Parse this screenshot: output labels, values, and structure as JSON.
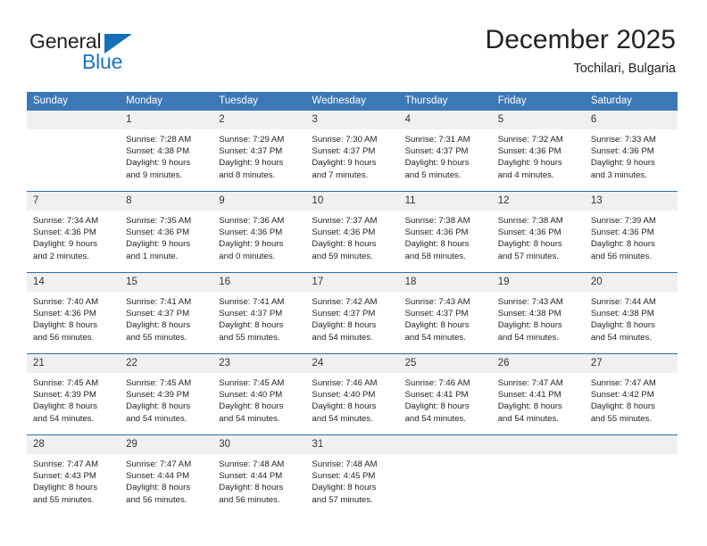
{
  "brand": {
    "name_top": "General",
    "name_bottom": "Blue",
    "triangle_color": "#1271b8",
    "blue_color": "#1b75bb",
    "dark_color": "#231f20"
  },
  "header": {
    "title": "December 2025",
    "location": "Tochilari, Bulgaria"
  },
  "theme": {
    "header_row_bg": "#3c78b5",
    "header_row_text": "#ffffff",
    "daynum_bg": "#f0f0f0",
    "row_divider": "#2e6da4",
    "body_text": "#242424"
  },
  "weekdays": [
    "Sunday",
    "Monday",
    "Tuesday",
    "Wednesday",
    "Thursday",
    "Friday",
    "Saturday"
  ],
  "weeks": [
    [
      {
        "day": "",
        "empty": true,
        "sunrise": "",
        "sunset": "",
        "daylight_line1": "",
        "daylight_line2": ""
      },
      {
        "day": "1",
        "empty": false,
        "sunrise": "Sunrise: 7:28 AM",
        "sunset": "Sunset: 4:38 PM",
        "daylight_line1": "Daylight: 9 hours",
        "daylight_line2": "and 9 minutes."
      },
      {
        "day": "2",
        "empty": false,
        "sunrise": "Sunrise: 7:29 AM",
        "sunset": "Sunset: 4:37 PM",
        "daylight_line1": "Daylight: 9 hours",
        "daylight_line2": "and 8 minutes."
      },
      {
        "day": "3",
        "empty": false,
        "sunrise": "Sunrise: 7:30 AM",
        "sunset": "Sunset: 4:37 PM",
        "daylight_line1": "Daylight: 9 hours",
        "daylight_line2": "and 7 minutes."
      },
      {
        "day": "4",
        "empty": false,
        "sunrise": "Sunrise: 7:31 AM",
        "sunset": "Sunset: 4:37 PM",
        "daylight_line1": "Daylight: 9 hours",
        "daylight_line2": "and 5 minutes."
      },
      {
        "day": "5",
        "empty": false,
        "sunrise": "Sunrise: 7:32 AM",
        "sunset": "Sunset: 4:36 PM",
        "daylight_line1": "Daylight: 9 hours",
        "daylight_line2": "and 4 minutes."
      },
      {
        "day": "6",
        "empty": false,
        "sunrise": "Sunrise: 7:33 AM",
        "sunset": "Sunset: 4:36 PM",
        "daylight_line1": "Daylight: 9 hours",
        "daylight_line2": "and 3 minutes."
      }
    ],
    [
      {
        "day": "7",
        "empty": false,
        "sunrise": "Sunrise: 7:34 AM",
        "sunset": "Sunset: 4:36 PM",
        "daylight_line1": "Daylight: 9 hours",
        "daylight_line2": "and 2 minutes."
      },
      {
        "day": "8",
        "empty": false,
        "sunrise": "Sunrise: 7:35 AM",
        "sunset": "Sunset: 4:36 PM",
        "daylight_line1": "Daylight: 9 hours",
        "daylight_line2": "and 1 minute."
      },
      {
        "day": "9",
        "empty": false,
        "sunrise": "Sunrise: 7:36 AM",
        "sunset": "Sunset: 4:36 PM",
        "daylight_line1": "Daylight: 9 hours",
        "daylight_line2": "and 0 minutes."
      },
      {
        "day": "10",
        "empty": false,
        "sunrise": "Sunrise: 7:37 AM",
        "sunset": "Sunset: 4:36 PM",
        "daylight_line1": "Daylight: 8 hours",
        "daylight_line2": "and 59 minutes."
      },
      {
        "day": "11",
        "empty": false,
        "sunrise": "Sunrise: 7:38 AM",
        "sunset": "Sunset: 4:36 PM",
        "daylight_line1": "Daylight: 8 hours",
        "daylight_line2": "and 58 minutes."
      },
      {
        "day": "12",
        "empty": false,
        "sunrise": "Sunrise: 7:38 AM",
        "sunset": "Sunset: 4:36 PM",
        "daylight_line1": "Daylight: 8 hours",
        "daylight_line2": "and 57 minutes."
      },
      {
        "day": "13",
        "empty": false,
        "sunrise": "Sunrise: 7:39 AM",
        "sunset": "Sunset: 4:36 PM",
        "daylight_line1": "Daylight: 8 hours",
        "daylight_line2": "and 56 minutes."
      }
    ],
    [
      {
        "day": "14",
        "empty": false,
        "sunrise": "Sunrise: 7:40 AM",
        "sunset": "Sunset: 4:36 PM",
        "daylight_line1": "Daylight: 8 hours",
        "daylight_line2": "and 56 minutes."
      },
      {
        "day": "15",
        "empty": false,
        "sunrise": "Sunrise: 7:41 AM",
        "sunset": "Sunset: 4:37 PM",
        "daylight_line1": "Daylight: 8 hours",
        "daylight_line2": "and 55 minutes."
      },
      {
        "day": "16",
        "empty": false,
        "sunrise": "Sunrise: 7:41 AM",
        "sunset": "Sunset: 4:37 PM",
        "daylight_line1": "Daylight: 8 hours",
        "daylight_line2": "and 55 minutes."
      },
      {
        "day": "17",
        "empty": false,
        "sunrise": "Sunrise: 7:42 AM",
        "sunset": "Sunset: 4:37 PM",
        "daylight_line1": "Daylight: 8 hours",
        "daylight_line2": "and 54 minutes."
      },
      {
        "day": "18",
        "empty": false,
        "sunrise": "Sunrise: 7:43 AM",
        "sunset": "Sunset: 4:37 PM",
        "daylight_line1": "Daylight: 8 hours",
        "daylight_line2": "and 54 minutes."
      },
      {
        "day": "19",
        "empty": false,
        "sunrise": "Sunrise: 7:43 AM",
        "sunset": "Sunset: 4:38 PM",
        "daylight_line1": "Daylight: 8 hours",
        "daylight_line2": "and 54 minutes."
      },
      {
        "day": "20",
        "empty": false,
        "sunrise": "Sunrise: 7:44 AM",
        "sunset": "Sunset: 4:38 PM",
        "daylight_line1": "Daylight: 8 hours",
        "daylight_line2": "and 54 minutes."
      }
    ],
    [
      {
        "day": "21",
        "empty": false,
        "sunrise": "Sunrise: 7:45 AM",
        "sunset": "Sunset: 4:39 PM",
        "daylight_line1": "Daylight: 8 hours",
        "daylight_line2": "and 54 minutes."
      },
      {
        "day": "22",
        "empty": false,
        "sunrise": "Sunrise: 7:45 AM",
        "sunset": "Sunset: 4:39 PM",
        "daylight_line1": "Daylight: 8 hours",
        "daylight_line2": "and 54 minutes."
      },
      {
        "day": "23",
        "empty": false,
        "sunrise": "Sunrise: 7:45 AM",
        "sunset": "Sunset: 4:40 PM",
        "daylight_line1": "Daylight: 8 hours",
        "daylight_line2": "and 54 minutes."
      },
      {
        "day": "24",
        "empty": false,
        "sunrise": "Sunrise: 7:46 AM",
        "sunset": "Sunset: 4:40 PM",
        "daylight_line1": "Daylight: 8 hours",
        "daylight_line2": "and 54 minutes."
      },
      {
        "day": "25",
        "empty": false,
        "sunrise": "Sunrise: 7:46 AM",
        "sunset": "Sunset: 4:41 PM",
        "daylight_line1": "Daylight: 8 hours",
        "daylight_line2": "and 54 minutes."
      },
      {
        "day": "26",
        "empty": false,
        "sunrise": "Sunrise: 7:47 AM",
        "sunset": "Sunset: 4:41 PM",
        "daylight_line1": "Daylight: 8 hours",
        "daylight_line2": "and 54 minutes."
      },
      {
        "day": "27",
        "empty": false,
        "sunrise": "Sunrise: 7:47 AM",
        "sunset": "Sunset: 4:42 PM",
        "daylight_line1": "Daylight: 8 hours",
        "daylight_line2": "and 55 minutes."
      }
    ],
    [
      {
        "day": "28",
        "empty": false,
        "sunrise": "Sunrise: 7:47 AM",
        "sunset": "Sunset: 4:43 PM",
        "daylight_line1": "Daylight: 8 hours",
        "daylight_line2": "and 55 minutes."
      },
      {
        "day": "29",
        "empty": false,
        "sunrise": "Sunrise: 7:47 AM",
        "sunset": "Sunset: 4:44 PM",
        "daylight_line1": "Daylight: 8 hours",
        "daylight_line2": "and 56 minutes."
      },
      {
        "day": "30",
        "empty": false,
        "sunrise": "Sunrise: 7:48 AM",
        "sunset": "Sunset: 4:44 PM",
        "daylight_line1": "Daylight: 8 hours",
        "daylight_line2": "and 56 minutes."
      },
      {
        "day": "31",
        "empty": false,
        "sunrise": "Sunrise: 7:48 AM",
        "sunset": "Sunset: 4:45 PM",
        "daylight_line1": "Daylight: 8 hours",
        "daylight_line2": "and 57 minutes."
      },
      {
        "day": "",
        "empty": true,
        "sunrise": "",
        "sunset": "",
        "daylight_line1": "",
        "daylight_line2": ""
      },
      {
        "day": "",
        "empty": true,
        "sunrise": "",
        "sunset": "",
        "daylight_line1": "",
        "daylight_line2": ""
      },
      {
        "day": "",
        "empty": true,
        "sunrise": "",
        "sunset": "",
        "daylight_line1": "",
        "daylight_line2": ""
      }
    ]
  ]
}
